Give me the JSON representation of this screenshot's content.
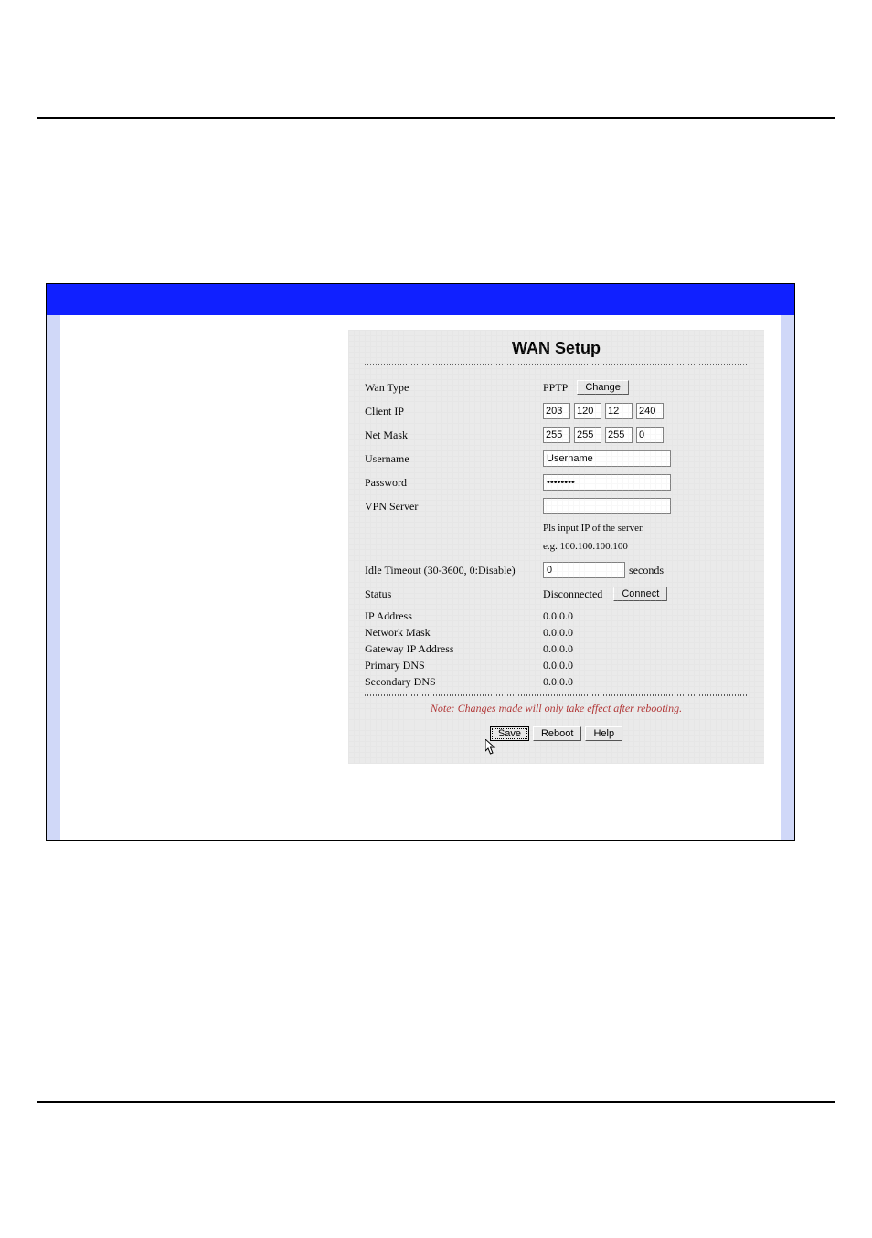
{
  "panel": {
    "title": "WAN Setup",
    "wanType": {
      "label": "Wan Type",
      "value": "PPTP",
      "changeBtn": "Change"
    },
    "clientIp": {
      "label": "Client IP",
      "oct": [
        "203",
        "120",
        "12",
        "240"
      ]
    },
    "netMask": {
      "label": "Net Mask",
      "oct": [
        "255",
        "255",
        "255",
        "0"
      ]
    },
    "username": {
      "label": "Username",
      "value": "Username"
    },
    "password": {
      "label": "Password",
      "value": "••••••••"
    },
    "vpnServer": {
      "label": "VPN Server",
      "value": "",
      "hint1": "Pls input IP of the server.",
      "hint2": "e.g. 100.100.100.100"
    },
    "idle": {
      "label": "Idle Timeout (30-3600, 0:Disable)",
      "value": "0",
      "unit": "seconds"
    },
    "status": {
      "label": "Status",
      "value": "Disconnected",
      "connectBtn": "Connect"
    },
    "readonly": [
      {
        "label": "IP Address",
        "value": "0.0.0.0"
      },
      {
        "label": "Network Mask",
        "value": "0.0.0.0"
      },
      {
        "label": "Gateway IP Address",
        "value": "0.0.0.0"
      },
      {
        "label": "Primary DNS",
        "value": "0.0.0.0"
      },
      {
        "label": "Secondary DNS",
        "value": "0.0.0.0"
      }
    ],
    "note": "Note: Changes made will only take effect after rebooting.",
    "buttons": {
      "save": "Save",
      "reboot": "Reboot",
      "help": "Help"
    }
  }
}
